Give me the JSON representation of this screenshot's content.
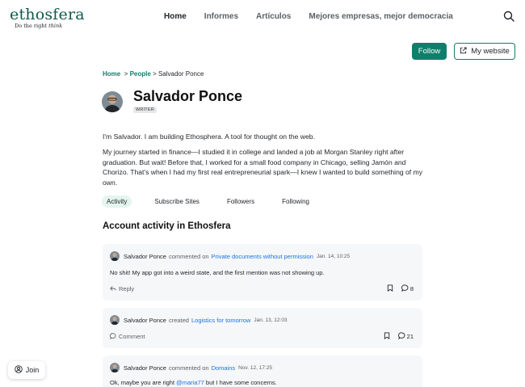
{
  "brand": {
    "name": "ethosfera",
    "tagline_pre": "Do the right ",
    "tagline_em": "think"
  },
  "nav": {
    "home": "Home",
    "reports": "Informes",
    "articles": "Artículos",
    "best_companies": "Mejores empresas, mejor democracia"
  },
  "actions": {
    "follow": "Follow",
    "website": "My website"
  },
  "breadcrumb": {
    "home": "Home",
    "sep1": ">",
    "people": "People",
    "sep2": ">",
    "current": "Salvador Ponce"
  },
  "profile": {
    "name": "Salvador Ponce",
    "role": "WRITER",
    "bio_1": "I'm Salvador. I am building Ethosphera. A tool for thought on the web.",
    "bio_2": "My journey started in finance—I studied it in college and landed a job at Morgan Stanley right after graduation. But wait! Before that, I worked for a small food company in Chicago, selling Jamón and Chorizo. That's when I had my first real entrepreneurial spark—I knew I wanted to build something of my own."
  },
  "tabs": {
    "activity": "Activity",
    "subscribe_sites": "Subscribe Sites",
    "followers": "Followers",
    "following": "Following"
  },
  "section": {
    "title": "Account activity in Ethosfera"
  },
  "activity": [
    {
      "user": "Salvador Ponce",
      "action": "commented on",
      "target": "Private documents without permission",
      "time": "Jan. 14, 10:25",
      "body": "No shit! My app got into a weird state, and the first mention was not showing up.",
      "footer_action": "Reply",
      "comments": "8"
    },
    {
      "user": "Salvador Ponce",
      "action": "created",
      "target": "Logistics for tomorrow",
      "time": "Jan. 13, 12:03",
      "footer_action": "Comment",
      "comments": "21"
    },
    {
      "user": "Salvador Ponce",
      "action": "commented on",
      "target": "Domains",
      "time": "Nov. 12, 17:25",
      "body_pre": "Ok, maybe you are right ",
      "body_mention": "@maria77",
      "body_post": " but I have some concerns."
    }
  ],
  "join": {
    "label": "Join"
  },
  "colors": {
    "brand_green": "#0f7f6b",
    "link_blue": "#1a73e8",
    "tab_active_bg": "#e4f5ee",
    "card_bg": "#f6f7f8"
  },
  "icons": {
    "search": "search-icon",
    "external_link": "external-link-icon",
    "reply": "reply-icon",
    "comment": "comment-icon",
    "bookmark": "bookmark-icon",
    "user": "user-icon"
  }
}
